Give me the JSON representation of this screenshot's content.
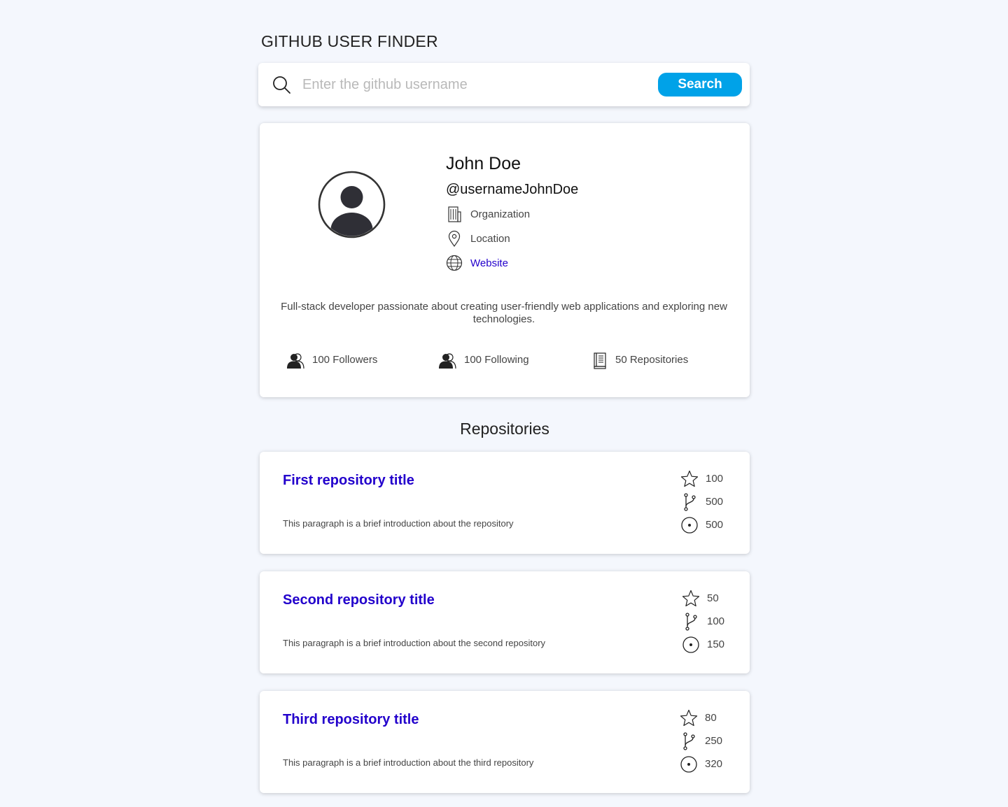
{
  "app_title": "GITHUB USER FINDER",
  "search": {
    "placeholder": "Enter the github username",
    "value": "",
    "button_label": "Search"
  },
  "profile": {
    "name": "John Doe",
    "username": "@usernameJohnDoe",
    "organization": "Organization",
    "location": "Location",
    "website": "Website",
    "bio": "Full-stack developer passionate about creating user-friendly web applications and exploring new technologies.",
    "stats": {
      "followers": "100 Followers",
      "following": "100 Following",
      "repositories": "50 Repositories"
    }
  },
  "repositories_heading": "Repositories",
  "repositories": [
    {
      "title": "First repository title",
      "description": "This paragraph is a brief introduction about the repository",
      "stars": "100",
      "forks": "500",
      "issues": "500"
    },
    {
      "title": "Second repository title",
      "description": "This paragraph is a brief introduction about the second repository",
      "stars": "50",
      "forks": "100",
      "issues": "150"
    },
    {
      "title": "Third repository title",
      "description": "This paragraph is a brief introduction about the third repository",
      "stars": "80",
      "forks": "250",
      "issues": "320"
    }
  ],
  "colors": {
    "background": "#f4f7fd",
    "accent": "#00a2e8",
    "link": "#2200cc"
  },
  "icons": {
    "search": "search-icon",
    "organization": "building-icon",
    "location": "map-pin-icon",
    "website": "globe-icon",
    "followers": "users-icon",
    "following": "users-icon",
    "repositories": "book-icon",
    "stars": "star-icon",
    "forks": "git-branch-icon",
    "issues": "issue-circle-icon"
  }
}
